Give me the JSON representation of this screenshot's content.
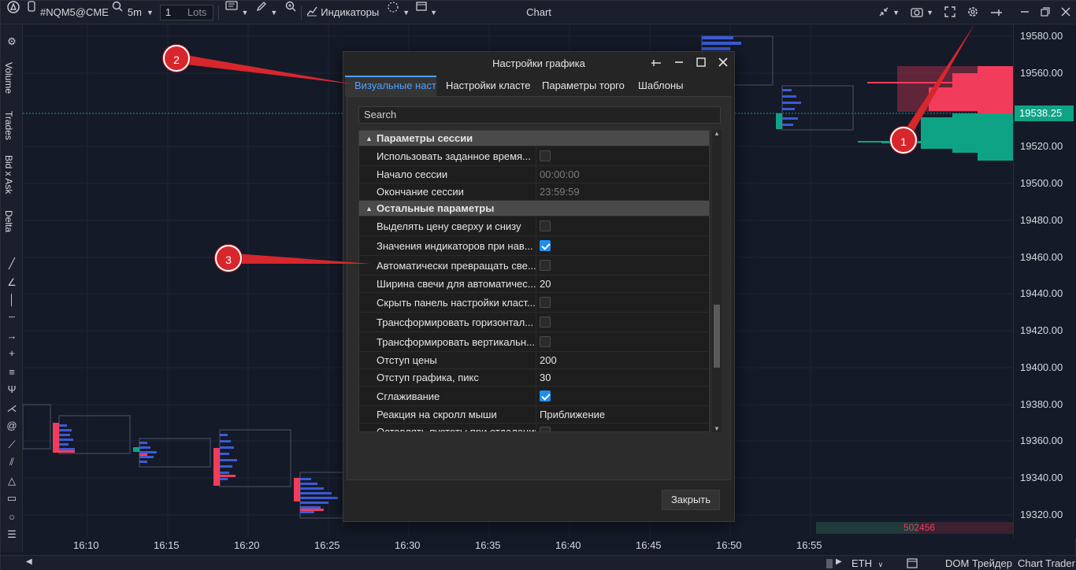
{
  "topbar": {
    "symbol": "#NQM5@CME",
    "timeframe": "5m",
    "quantity": "1",
    "lots_label": "Lots",
    "indicators_label": "Индикаторы",
    "window_title": "Chart"
  },
  "left_tabs": [
    "Volume",
    "Trades",
    "Bid x Ask",
    "Delta"
  ],
  "price_axis": {
    "labels": [
      "19580.00",
      "19560.00",
      "19520.00",
      "19500.00",
      "19480.00",
      "19460.00",
      "19440.00",
      "19420.00",
      "19400.00",
      "19380.00",
      "19360.00",
      "19340.00",
      "19320.00"
    ],
    "current_price": "19538.25"
  },
  "time_axis": {
    "labels": [
      "16:10",
      "16:15",
      "16:20",
      "16:25",
      "16:30",
      "16:35",
      "16:40",
      "16:45",
      "16:50",
      "16:55"
    ]
  },
  "volume_readout": "502456",
  "statusbar": {
    "currency": "ETH",
    "dom_trader": "DOM Трейдер",
    "chart_trader": "Chart Trader"
  },
  "dialog": {
    "title": "Настройки графика",
    "tabs": [
      "Визуальные настр",
      "Настройки класте",
      "Параметры торго",
      "Шаблоны"
    ],
    "search_placeholder": "Search",
    "sections": [
      {
        "title": "Параметры сессии",
        "rows": [
          {
            "label": "Использовать заданное время...",
            "type": "checkbox",
            "checked": false
          },
          {
            "label": "Начало сессии",
            "type": "text",
            "value": "00:00:00",
            "disabled": true
          },
          {
            "label": "Окончание сессии",
            "type": "text",
            "value": "23:59:59",
            "disabled": true
          }
        ]
      },
      {
        "title": "Остальные параметры",
        "rows": [
          {
            "label": "Выделять цену сверху и снизу",
            "type": "checkbox",
            "checked": false
          },
          {
            "label": "Значения индикаторов при нав...",
            "type": "checkbox",
            "checked": true
          },
          {
            "label": "Автоматически превращать све...",
            "type": "checkbox",
            "checked": false
          },
          {
            "label": "Ширина свечи для автоматичес...",
            "type": "text",
            "value": "20"
          },
          {
            "label": "Скрыть панель настройки класт...",
            "type": "checkbox",
            "checked": false
          },
          {
            "label": "Трансформировать горизонтал...",
            "type": "checkbox",
            "checked": false
          },
          {
            "label": "Трансформировать вертикальн...",
            "type": "checkbox",
            "checked": false
          },
          {
            "label": "Отступ цены",
            "type": "text",
            "value": "200"
          },
          {
            "label": "Отступ графика, пикс",
            "type": "text",
            "value": "30"
          },
          {
            "label": "Сглаживание",
            "type": "checkbox",
            "checked": true
          },
          {
            "label": "Реакция на скролл мыши",
            "type": "text",
            "value": "Приближение"
          },
          {
            "label": "Оставлять пустоты при отдалении",
            "type": "checkbox",
            "checked": false
          }
        ]
      }
    ],
    "close_label": "Закрыть"
  },
  "callouts": [
    "1",
    "2",
    "3"
  ],
  "colors": {
    "bid": "#f23c5b",
    "ask": "#0fa386",
    "accent": "#4ea1ff",
    "callout": "#d8262d"
  }
}
